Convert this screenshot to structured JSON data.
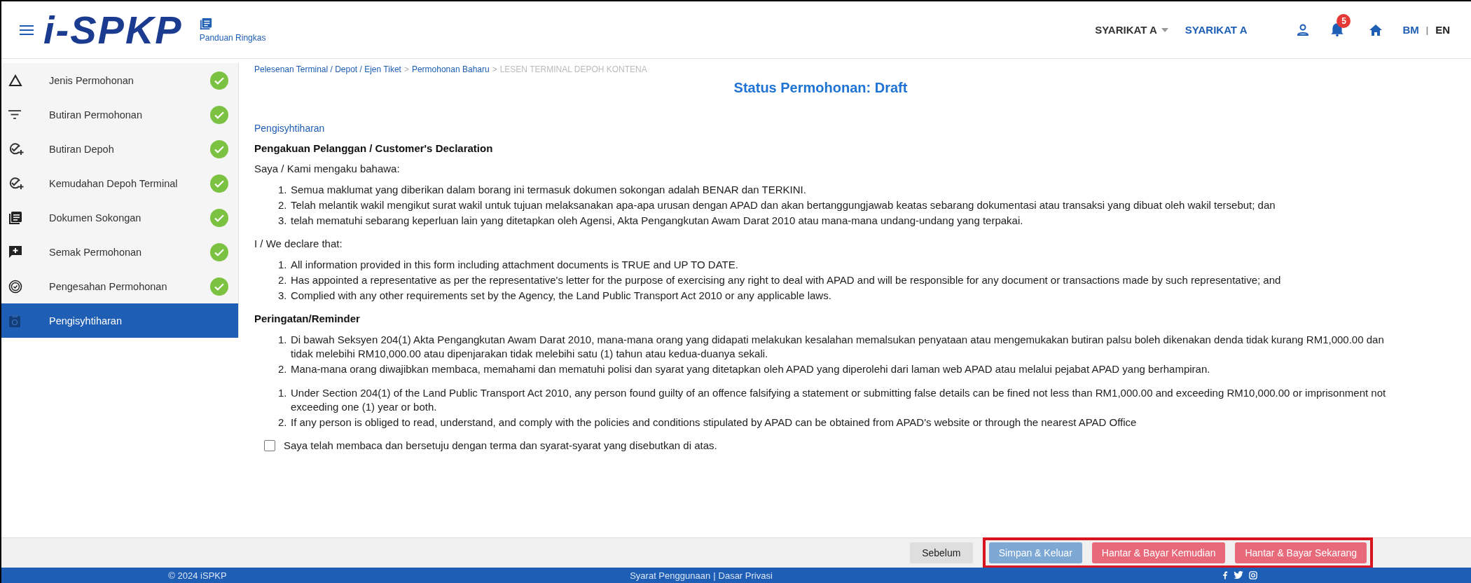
{
  "header": {
    "logo_text": "i-SPKP",
    "guide_link": "Panduan Ringkas",
    "company_menu": "SYARIKAT A",
    "company_name": "SYARIKAT A",
    "notification_count": "5",
    "languages": [
      {
        "label": "BM",
        "selected": false
      },
      {
        "label": "EN",
        "selected": true
      }
    ],
    "language_separator": "|"
  },
  "sidebar": {
    "items": [
      {
        "label": "Jenis Permohonan",
        "kind": "triangle",
        "completed": true,
        "selected": false
      },
      {
        "label": "Butiran Permohonan",
        "kind": "filter",
        "completed": true,
        "selected": false
      },
      {
        "label": "Butiran Depoh",
        "kind": "check-add",
        "completed": true,
        "selected": false
      },
      {
        "label": "Kemudahan Depoh Terminal",
        "kind": "check-add",
        "completed": true,
        "selected": false
      },
      {
        "label": "Dokumen Sokongan",
        "kind": "documents",
        "completed": true,
        "selected": false
      },
      {
        "label": "Semak Permohonan",
        "kind": "comment",
        "completed": true,
        "selected": false
      },
      {
        "label": "Pengesahan Permohonan",
        "kind": "badge",
        "completed": true,
        "selected": false
      },
      {
        "label": "Pengisyhtiharan",
        "kind": "clipboard",
        "completed": false,
        "selected": true
      }
    ]
  },
  "breadcrumb": {
    "separator": ">",
    "items": [
      {
        "label": "Pelesenan Terminal / Depot / Ejen Tiket",
        "current": false
      },
      {
        "label": "Permohonan Baharu",
        "current": false
      },
      {
        "label": "LESEN TERMINAL DEPOH KONTENA",
        "current": true
      }
    ]
  },
  "status_title": "Status Permohonan: Draft",
  "section_title": "Pengisyhtiharan",
  "declaration": {
    "heading": "Pengakuan Pelanggan / Customer's Declaration",
    "groups": [
      {
        "intro": "Saya / Kami mengaku bahawa:",
        "items": [
          {
            "number": "1.",
            "text": "Semua maklumat yang diberikan dalam borang ini termasuk dokumen sokongan adalah BENAR dan TERKINI."
          },
          {
            "number": "2.",
            "text": "Telah melantik wakil mengikut surat wakil untuk tujuan melaksanakan apa-apa urusan dengan APAD dan akan bertanggungjawab keatas sebarang dokumentasi atau transaksi yang dibuat oleh wakil tersebut; dan"
          },
          {
            "number": "3.",
            "text": "telah mematuhi sebarang keperluan lain yang ditetapkan oleh Agensi, Akta Pengangkutan Awam Darat 2010 atau mana-mana undang-undang yang terpakai."
          }
        ]
      },
      {
        "intro": "I / We declare that:",
        "items": [
          {
            "number": "1.",
            "text": "All information provided in this form including attachment documents is TRUE and UP TO DATE."
          },
          {
            "number": "2.",
            "text": "Has appointed a representative as per the representative's letter for the purpose of exercising any right to deal with APAD and will be responsible for any document or transactions made by such representative; and"
          },
          {
            "number": "3.",
            "text": "Complied with any other requirements set by the Agency, the Land Public Transport Act 2010 or any applicable laws."
          }
        ]
      }
    ]
  },
  "reminder": {
    "heading": "Peringatan/Reminder",
    "groups": [
      {
        "items": [
          {
            "number": "1.",
            "text": "Di bawah Seksyen 204(1) Akta Pengangkutan Awam Darat 2010, mana-mana orang yang didapati melakukan kesalahan memalsukan penyataan atau mengemukakan butiran palsu boleh dikenakan denda tidak kurang RM1,000.00 dan tidak melebihi RM10,000.00 atau dipenjarakan tidak melebihi satu (1) tahun atau kedua-duanya sekali."
          },
          {
            "number": "2.",
            "text": "Mana-mana orang diwajibkan membaca, memahami dan mematuhi polisi dan syarat yang ditetapkan oleh APAD yang diperolehi dari laman web APAD atau melalui pejabat APAD yang berhampiran."
          }
        ]
      },
      {
        "items": [
          {
            "number": "1.",
            "text": "Under Section 204(1) of the Land Public Transport Act 2010, any person found guilty of an offence falsifying a statement or submitting false details can be fined not less than RM1,000.00 and exceeding RM10,000.00 or imprisonment not exceeding one (1) year or both."
          },
          {
            "number": "2.",
            "text": "If any person is obliged to read, understand, and comply with the policies and conditions stipulated by APAD can be obtained from APAD's website or through the nearest APAD Office"
          }
        ]
      }
    ]
  },
  "agreement": {
    "label": "Saya telah membaca dan bersetuju dengan terma dan syarat-syarat yang disebutkan di atas.",
    "checked": false
  },
  "actions": [
    {
      "label": "Sebelum",
      "kind": "secondary"
    },
    {
      "label": "Simpan & Keluar",
      "kind": "save"
    },
    {
      "label": "Hantar & Bayar Kemudian",
      "kind": "submit"
    },
    {
      "label": "Hantar & Bayar Sekarang",
      "kind": "submit"
    }
  ],
  "footer": {
    "copyright": "© 2024 iSPKP",
    "links": [
      {
        "label": "Syarat Penggunaan"
      },
      {
        "label": "Dasar Privasi"
      }
    ],
    "link_separator": "|"
  }
}
